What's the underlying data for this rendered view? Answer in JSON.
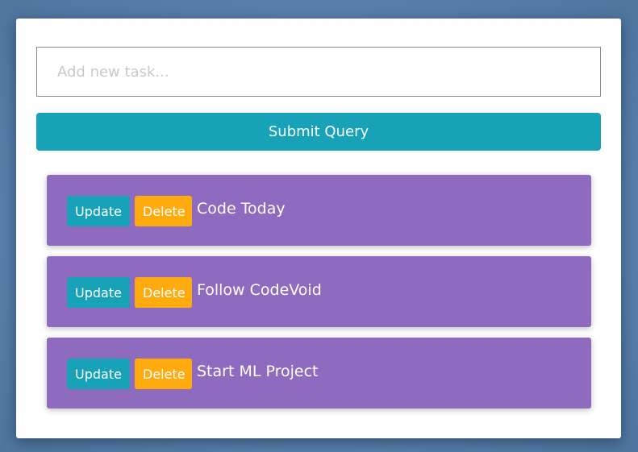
{
  "form": {
    "input_placeholder": "Add new task...",
    "input_value": "",
    "submit_label": "Submit Query"
  },
  "tasks": [
    {
      "text": "Code Today",
      "update_label": "Update",
      "delete_label": "Delete"
    },
    {
      "text": "Follow CodeVoid",
      "update_label": "Update",
      "delete_label": "Delete"
    },
    {
      "text": "Start ML Project",
      "update_label": "Update",
      "delete_label": "Delete"
    }
  ],
  "colors": {
    "background": "#6187b3",
    "card": "#ffffff",
    "primary": "#17a2b8",
    "warning": "#ffab0f",
    "task_item": "#8e6bbf"
  }
}
